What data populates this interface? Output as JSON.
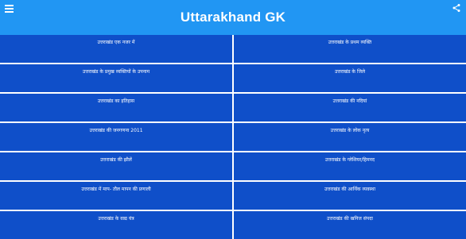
{
  "appbar": {
    "title": "Uttarakhand GK",
    "menu_icon": "hamburger-menu-icon",
    "share_icon": "share-icon"
  },
  "colors": {
    "appbar_bg": "#2196f3",
    "tile_bg": "#0f4fc9",
    "tile_text": "#ffffff",
    "divider": "#ffffff"
  },
  "menu": {
    "items": [
      {
        "label": "उत्तराखंड एक नजर में"
      },
      {
        "label": "उत्तराखंड के प्रथम व्यक्ति"
      },
      {
        "label": "उत्तराखंड के प्रमुख व्यक्तियों के उपनाम"
      },
      {
        "label": "उत्तराखंड के जिले"
      },
      {
        "label": "उत्तराखंड का इतिहास"
      },
      {
        "label": "उत्तराखंड की नदियां"
      },
      {
        "label": "उत्तराखंड की जनगणना 2011"
      },
      {
        "label": "उत्तराखंड के लोक नृत्य"
      },
      {
        "label": "उत्तराखंड की झीलें"
      },
      {
        "label": "उत्तराखंड के ग्लेशियर/हिमनद"
      },
      {
        "label": "उत्तराखंड में माप- तौल मापन की प्रणाली"
      },
      {
        "label": "उत्तराखंड की आर्थिक व्यवस्था"
      },
      {
        "label": "उत्तराखंड के वाद्य यंत्र"
      },
      {
        "label": "उत्तराखंड की खनिज संपदा"
      }
    ]
  }
}
